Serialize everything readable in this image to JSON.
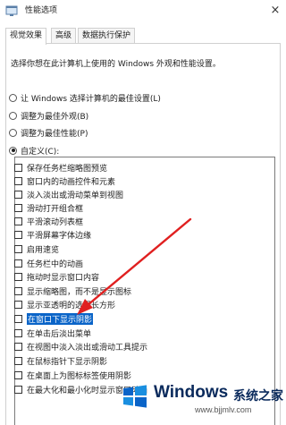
{
  "window": {
    "title": "性能选项",
    "close_glyph": "×"
  },
  "tabs": [
    {
      "label": "视觉效果",
      "active": true
    },
    {
      "label": "高级",
      "active": false
    },
    {
      "label": "数据执行保护",
      "active": false
    }
  ],
  "intro_text": "选择你想在此计算机上使用的 Windows 外观和性能设置。",
  "radio_options": [
    {
      "label": "让 Windows 选择计算机的最佳设置(L)",
      "checked": false
    },
    {
      "label": "调整为最佳外观(B)",
      "checked": false
    },
    {
      "label": "调整为最佳性能(P)",
      "checked": false
    },
    {
      "label": "自定义(C):",
      "checked": true
    }
  ],
  "effects": [
    {
      "label": "保存任务栏缩略图预览",
      "checked": false
    },
    {
      "label": "窗口内的动画控件和元素",
      "checked": false
    },
    {
      "label": "淡入淡出或滑动菜单到视图",
      "checked": false
    },
    {
      "label": "滑动打开组合框",
      "checked": false
    },
    {
      "label": "平滑滚动列表框",
      "checked": false
    },
    {
      "label": "平滑屏幕字体边缘",
      "checked": false
    },
    {
      "label": "启用速览",
      "checked": false
    },
    {
      "label": "任务栏中的动画",
      "checked": false
    },
    {
      "label": "拖动时显示窗口内容",
      "checked": false
    },
    {
      "label": "显示缩略图，而不是显示图标",
      "checked": false
    },
    {
      "label": "显示亚透明的选择长方形",
      "checked": false
    },
    {
      "label": "在窗口下显示阴影",
      "checked": false,
      "highlighted": true
    },
    {
      "label": "在单击后淡出菜单",
      "checked": false
    },
    {
      "label": "在视图中淡入淡出或滑动工具提示",
      "checked": false
    },
    {
      "label": "在鼠标指针下显示阴影",
      "checked": false
    },
    {
      "label": "在桌面上为图标标签使用阴影",
      "checked": false
    },
    {
      "label": "在最大化和最小化时显示窗口动画",
      "checked": false
    }
  ],
  "watermark": {
    "brand": "Windows",
    "cn_text": "系统之家",
    "url": "www.bjjmlv.com",
    "logo_colors": [
      "#0a64c8",
      "#1a8fe0",
      "#0a64c8",
      "#1a8fe0"
    ]
  },
  "annotation": {
    "arrow_color": "#e02020"
  }
}
